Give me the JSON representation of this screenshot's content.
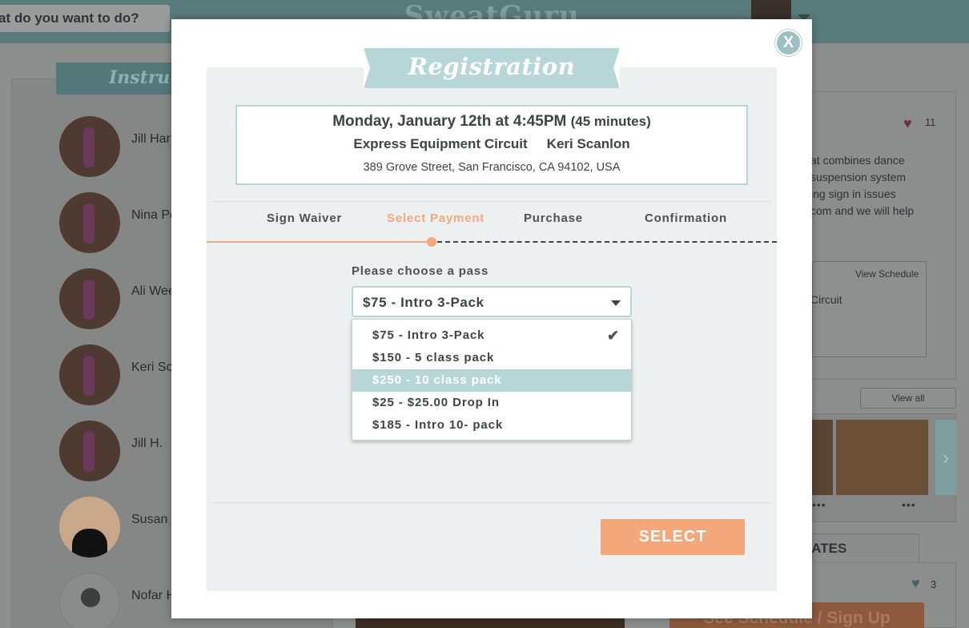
{
  "background": {
    "search_placeholder": "at do you want to do?",
    "logo": "SweatGuru",
    "instructors_title": "Instru",
    "instructors": [
      {
        "name": "Jill Har"
      },
      {
        "name": "Nina Pe"
      },
      {
        "name": "Ali Wee"
      },
      {
        "name": "Keri Sc"
      },
      {
        "name": "Jill H."
      },
      {
        "name": "Susan "
      },
      {
        "name": "Nofar H"
      }
    ],
    "right_text": [
      "at combines dance",
      "suspension system",
      "ing sign in issues",
      "com and we will help"
    ],
    "likes": "11",
    "view_schedule": "View Schedule",
    "schedule_item": "Circuit",
    "view_all": "View all",
    "dots": "•••",
    "tab_label": "RATES",
    "likes2": "3",
    "cta": "See Schedule / Sign Up"
  },
  "modal": {
    "title": "Registration",
    "close_label": "X",
    "class_info": {
      "datetime": "Monday, January 12th at 4:45PM",
      "duration": "(45 minutes)",
      "class_name": "Express Equipment Circuit",
      "instructor": "Keri Scanlon",
      "address": "389 Grove Street, San Francisco, CA 94102, USA"
    },
    "steps": [
      "Sign Waiver",
      "Select Payment",
      "Purchase",
      "Confirmation"
    ],
    "active_step": "Select Payment",
    "pass_label": "Please choose a pass",
    "selected_pass": "$75 - Intro 3-Pack",
    "options": [
      {
        "label": "$75 - Intro 3-Pack",
        "selected": true,
        "hovered": false
      },
      {
        "label": "$150 - 5 class pack",
        "selected": false,
        "hovered": false
      },
      {
        "label": "$250 - 10 class pack",
        "selected": false,
        "hovered": true
      },
      {
        "label": "$25 - $25.00 Drop In",
        "selected": false,
        "hovered": false
      },
      {
        "label": "$185 - Intro 10- pack",
        "selected": false,
        "hovered": false
      }
    ],
    "checkmark": "✔",
    "select_button": "SELECT"
  },
  "colors": {
    "accent_teal": "#b7d6d8",
    "accent_orange": "#f4a77a",
    "text_dark": "#3c4446",
    "panel_bg": "#ecf0f1"
  }
}
